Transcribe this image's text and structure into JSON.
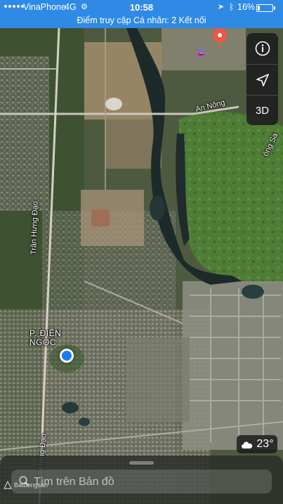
{
  "status_bar": {
    "carrier": "VinaPhone",
    "network": "4G",
    "time": "10:58",
    "battery_percent": "16%",
    "battery_level": 0.16,
    "banner": "Điểm truy cập Cá nhân: 2 Kết nối"
  },
  "map": {
    "labels": {
      "an_nong": "An Nông",
      "tran_hung_dao_upper": "Trần Hưng Đạo",
      "tran_hung_dao_lower": "ần Hưng Đạo",
      "dong_sa": "ông Sa",
      "district": "P. ĐIỆN\nNGỌC"
    },
    "icons": [
      "info-icon",
      "location-arrow-icon",
      "cloud-icon",
      "search-icon",
      "pin-icon"
    ]
  },
  "controls": {
    "info": "i",
    "three_d": "3D"
  },
  "weather": {
    "temperature": "23°"
  },
  "search": {
    "placeholder": "Tìm trên Bản đồ"
  },
  "watermark": "Batdongsan",
  "colors": {
    "status_blue": "#2f8ae5",
    "user_dot": "#1a7cf5",
    "pin_red": "#f05545"
  }
}
